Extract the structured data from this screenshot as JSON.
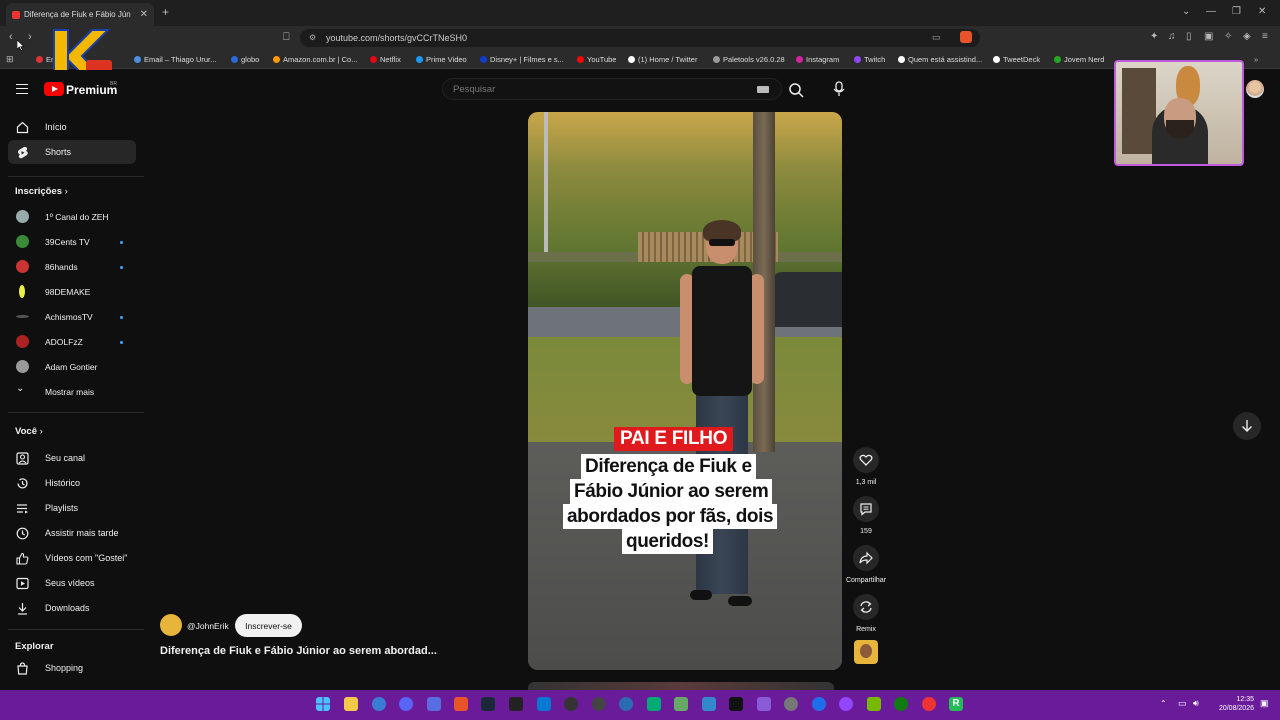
{
  "browser": {
    "tab_title": "Diferença de Fiuk e Fábio Jún",
    "url": "youtube.com/shorts/gvCCrTNeSH0",
    "bookmarks": [
      "Em",
      "Email – Thiago Urur...",
      "globo",
      "Amazon.com.br | Co...",
      "Netflix",
      "Prime Video",
      "Disney+ | Filmes e s...",
      "YouTube",
      "(1) Home / Twitter",
      "Paletools v26.0.28",
      "Instagram",
      "Twitch",
      "Quem está assistind...",
      "TweetDeck",
      "Jovem Nerd"
    ]
  },
  "header": {
    "brand": "Premium",
    "brand_region": "BR",
    "search_placeholder": "Pesquisar"
  },
  "sidebar": {
    "main": [
      {
        "label": "Início",
        "icon": "home-icon"
      },
      {
        "label": "Shorts",
        "icon": "shorts-icon"
      }
    ],
    "subscriptions_title": "Inscrições",
    "subscriptions": [
      {
        "label": "1º Canal do ZEH",
        "color": "#9aa",
        "dot": false
      },
      {
        "label": "39Cents TV",
        "color": "#3a8a3a",
        "dot": true
      },
      {
        "label": "86hands",
        "color": "#c33",
        "dot": true
      },
      {
        "label": "98DEMAKE",
        "color": "#ee4",
        "dot": false
      },
      {
        "label": "AchismosTV",
        "color": "#555",
        "dot": true
      },
      {
        "label": "ADOLFzZ",
        "color": "#a22",
        "dot": true
      },
      {
        "label": "Adam Gontier",
        "color": "#999",
        "dot": false
      }
    ],
    "show_more": "Mostrar mais",
    "you_title": "Você",
    "you": [
      {
        "label": "Seu canal",
        "icon": "channel-icon"
      },
      {
        "label": "Histórico",
        "icon": "history-icon"
      },
      {
        "label": "Playlists",
        "icon": "playlists-icon"
      },
      {
        "label": "Assistir mais tarde",
        "icon": "watch-later-icon"
      },
      {
        "label": "Vídeos com \"Gostei\"",
        "icon": "like-icon"
      },
      {
        "label": "Seus vídeos",
        "icon": "your-videos-icon"
      },
      {
        "label": "Downloads",
        "icon": "download-icon"
      }
    ],
    "explore_title": "Explorar",
    "explore": [
      {
        "label": "Shopping",
        "icon": "shopping-icon"
      }
    ]
  },
  "short": {
    "tag": "PAI E FILHO",
    "caption_lines": [
      "Diferença de Fiuk e",
      "Fábio Júnior ao serem",
      "abordados por fãs, dois",
      "queridos!"
    ],
    "channel": "@JohnErik",
    "subscribe": "Inscrever-se",
    "title": "Diferença de Fiuk e Fábio Júnior ao serem abordad...",
    "likes": "1,3 mil",
    "comments": "159",
    "share": "Compartilhar",
    "remix": "Remix"
  },
  "taskbar": {
    "time": "12:35",
    "date": "20/08/2026"
  },
  "colors": {
    "accent": "#f00",
    "taskbar": "#6a1b9a",
    "cam_border": "#c05be0"
  }
}
